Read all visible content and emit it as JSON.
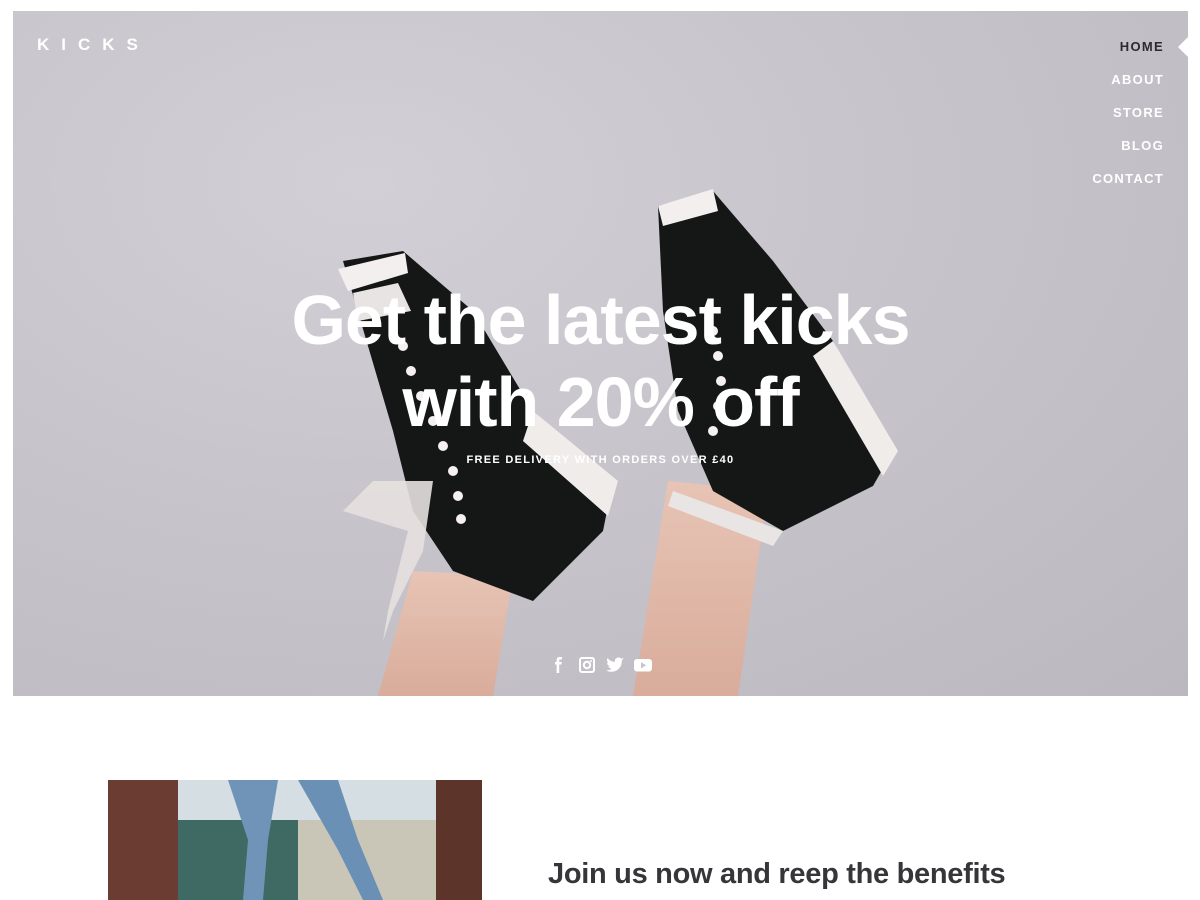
{
  "brand": {
    "logo": "KICKS"
  },
  "nav": {
    "items": [
      {
        "label": "HOME",
        "active": true
      },
      {
        "label": "ABOUT",
        "active": false
      },
      {
        "label": "STORE",
        "active": false
      },
      {
        "label": "BLOG",
        "active": false
      },
      {
        "label": "CONTACT",
        "active": false
      }
    ]
  },
  "hero": {
    "headline_line1": "Get the latest kicks",
    "headline_line2": "with 20% off",
    "subline": "FREE DELIVERY WITH ORDERS OVER £40",
    "social": [
      "facebook-icon",
      "instagram-icon",
      "twitter-icon",
      "youtube-icon"
    ]
  },
  "feature": {
    "heading": "Join us now and reep the benefits"
  },
  "colors": {
    "hero_bg": "#c7c4cb",
    "nav_active": "#2b2b2e",
    "text_white": "#ffffff",
    "heading_dark": "#36363a"
  }
}
